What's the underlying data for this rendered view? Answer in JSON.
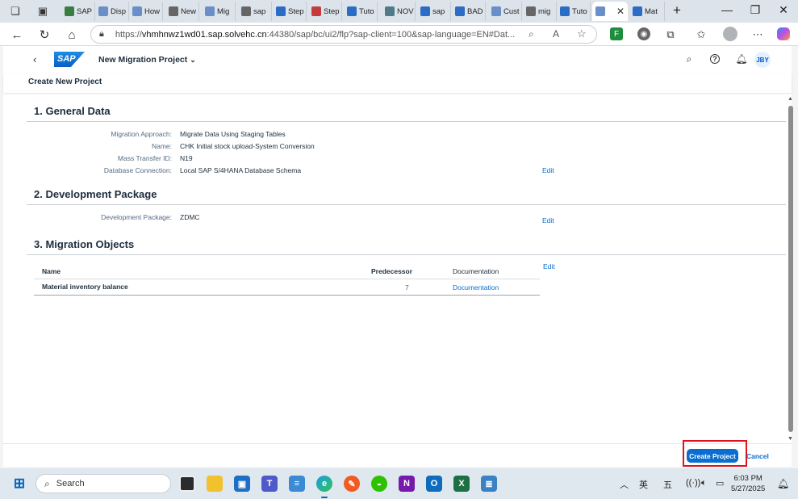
{
  "browser": {
    "tabs": [
      {
        "label": "SAP",
        "color": "#3a7d44"
      },
      {
        "label": "Disp",
        "color": "#6a8ec8"
      },
      {
        "label": "How",
        "color": "#6a8ec8"
      },
      {
        "label": "New",
        "color": "#666"
      },
      {
        "label": "Mig",
        "color": "#6a8ec8"
      },
      {
        "label": "sap",
        "color": "#666"
      },
      {
        "label": "Step",
        "color": "#2b6cc4"
      },
      {
        "label": "Step",
        "color": "#c43b3b"
      },
      {
        "label": "Tuto",
        "color": "#2b6cc4"
      },
      {
        "label": "NOV",
        "color": "#4f7a8a"
      },
      {
        "label": "sap",
        "color": "#2b6cc4"
      },
      {
        "label": "BAD",
        "color": "#2b6cc4"
      },
      {
        "label": "Cust",
        "color": "#6a8ec8"
      },
      {
        "label": "mig",
        "color": "#666"
      },
      {
        "label": "Tuto",
        "color": "#2b6cc4"
      },
      {
        "label": "",
        "color": "#6a8ec8"
      },
      {
        "label": "Mat",
        "color": "#2b6cc4"
      }
    ],
    "url_prefix": "https://",
    "url_host": "vhmhnwz1wd01.sap.solvehc.cn",
    "url_rest": ":44380/sap/bc/ui2/flp?sap-client=100&sap-language=EN#Dat..."
  },
  "shell": {
    "app_title": "New Migration Project",
    "avatar": "JBY",
    "page_title": "Create New Project"
  },
  "sections": {
    "general": {
      "title": "1. General Data",
      "fields": [
        {
          "label": "Migration Approach:",
          "value": "Migrate Data Using Staging Tables"
        },
        {
          "label": "Name:",
          "value": "CHK Initial stock upload-System Conversion"
        },
        {
          "label": "Mass Transfer ID:",
          "value": "N19"
        },
        {
          "label": "Database Connection:",
          "value": "Local SAP S/4HANA Database Schema"
        }
      ],
      "edit": "Edit"
    },
    "devpkg": {
      "title": "2. Development Package",
      "fields": [
        {
          "label": "Development Package:",
          "value": "ZDMC"
        }
      ],
      "edit": "Edit"
    },
    "objects": {
      "title": "3. Migration Objects",
      "edit": "Edit",
      "columns": [
        "Name",
        "Predecessor",
        "Documentation"
      ],
      "rows": [
        {
          "name": "Material inventory balance",
          "predecessor": "7",
          "documentation": "Documentation"
        }
      ]
    }
  },
  "footer": {
    "create_label": "Create Project",
    "cancel_label": "Cancel"
  },
  "taskbar": {
    "search_placeholder": "Search",
    "ime_1": "英",
    "ime_2": "五",
    "time": "6:03 PM",
    "date": "5/27/2025"
  },
  "colors": {
    "accent": "#0a6ed1",
    "highlight": "#e0121e"
  }
}
